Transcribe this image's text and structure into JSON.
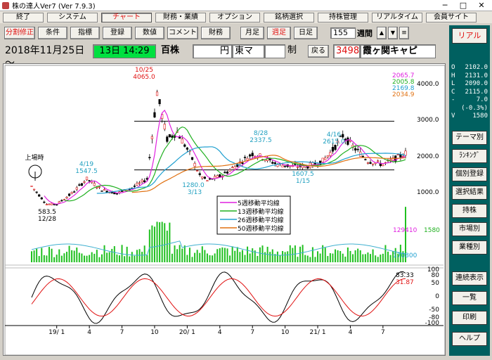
{
  "window": {
    "title": "株の達人Ver7 (Ver 7.9.3)",
    "minimize": "─",
    "maximize": "□",
    "close": "✕"
  },
  "menu": [
    "終了",
    "システム",
    "チャート",
    "財務・業績",
    "オプション",
    "銘柄選択",
    "持株管理",
    "リアルタイム",
    "会員サイト"
  ],
  "menu_active": 2,
  "toolbar": {
    "buttons": [
      "分割修正",
      "条件",
      "指標",
      "登録",
      "数値",
      "コメント",
      "財務",
      "月足",
      "週足",
      "日足"
    ],
    "red_buttons": [
      0,
      8
    ],
    "count": "155",
    "period": "週間",
    "up": "▲",
    "down": "▼",
    "list": "≡"
  },
  "realtime_btn": "リアル",
  "info": {
    "date": "2018年11月25日 ～",
    "range": "13日 14:29",
    "unit": "百株",
    "currency": "円",
    "market": "東マ",
    "blank1": "",
    "cond": "制",
    "back": "戻る",
    "code": "3498",
    "name": "霞ヶ関キャピ"
  },
  "ohlc": [
    {
      "k": "O",
      "v": "2102.0"
    },
    {
      "k": "H",
      "v": "2131.0"
    },
    {
      "k": "L",
      "v": "2090.0"
    },
    {
      "k": "C",
      "v": "2115.0"
    },
    {
      "k": "-",
      "v": "7.0"
    },
    {
      "k": "",
      "v": "(-0.3%)"
    },
    {
      "k": "V",
      "v": "1580"
    }
  ],
  "sidebar": [
    "テーマ別",
    "ﾗﾝｷﾝｸﾞ",
    "個別登録",
    "選択結果",
    "持株",
    "市場別",
    "業種別",
    "連続表示",
    "一覧",
    "印刷",
    "ヘルプ"
  ],
  "price_chart": {
    "ma_values": [
      {
        "v": "2065.7",
        "color": "#e020e0"
      },
      {
        "v": "2005.8",
        "color": "#20b020"
      },
      {
        "v": "2169.8",
        "color": "#20a0d0"
      },
      {
        "v": "2034.9",
        "color": "#e07010"
      }
    ],
    "ylabels": [
      "4000.0",
      "3000.0",
      "2000.0",
      "1000.0"
    ],
    "annotations": [
      {
        "text": "10/25",
        "color": "#e01010"
      },
      {
        "text": "4065.0",
        "color": "#e01010"
      },
      {
        "text": "8/28",
        "color": "#20a0c0"
      },
      {
        "text": "2337.5",
        "color": "#20a0c0"
      },
      {
        "text": "4/16",
        "color": "#20a0c0"
      },
      {
        "text": "2615.0",
        "color": "#20a0c0"
      },
      {
        "text": "4/19",
        "color": "#20a0c0"
      },
      {
        "text": "1547.5",
        "color": "#20a0c0"
      },
      {
        "text": "1280.0",
        "color": "#20a0c0"
      },
      {
        "text": "3/13",
        "color": "#20a0c0"
      },
      {
        "text": "1607.5",
        "color": "#20a0c0"
      },
      {
        "text": "1/15",
        "color": "#20a0c0"
      },
      {
        "text": "583.5",
        "color": "#000"
      },
      {
        "text": "12/28",
        "color": "#000"
      },
      {
        "text": "上場時",
        "color": "#000"
      }
    ],
    "legend": [
      "5週移動平均線",
      "13週移動平均線",
      "26週移動平均線",
      "50週移動平均線"
    ],
    "legend_colors": [
      "#e020e0",
      "#20b020",
      "#20a0d0",
      "#e07010"
    ]
  },
  "volume": {
    "value": "129410",
    "today": "1580",
    "base": "170800"
  },
  "oscillator": {
    "v1": "83.33",
    "v2": "31.87",
    "scale": [
      "100",
      "80",
      "50",
      "0",
      "-50",
      "-80",
      "-100"
    ]
  },
  "xaxis": [
    "19/ 1",
    "4",
    "7",
    "10",
    "20/ 1",
    "4",
    "7",
    "10",
    "21/ 1",
    "4",
    "7"
  ]
}
